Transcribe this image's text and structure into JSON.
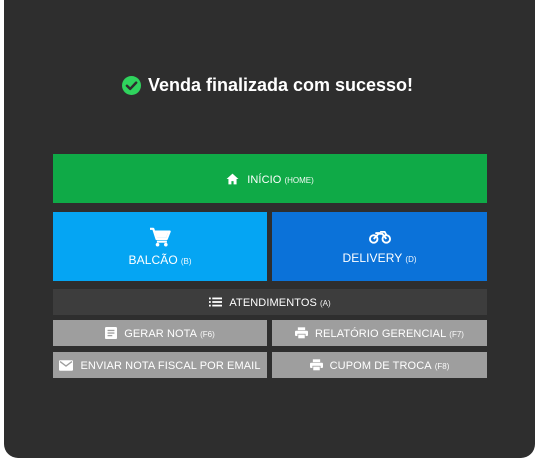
{
  "message": {
    "text": "Venda finalizada com sucesso!",
    "icon": "check-circle-icon",
    "icon_color": "#2fd35d"
  },
  "buttons": {
    "home": {
      "label": "INÍCIO",
      "key": "(HOME)",
      "icon": "home-icon",
      "color": "#0faa47"
    },
    "balcao": {
      "label": "BALCÃO",
      "key": "(B)",
      "icon": "cart-icon",
      "color": "#05a5f3"
    },
    "delivery": {
      "label": "DELIVERY",
      "key": "(D)",
      "icon": "motorcycle-icon",
      "color": "#0b72d9"
    },
    "atendimentos": {
      "label": "ATENDIMENTOS",
      "key": "(A)",
      "icon": "list-icon",
      "color": "#3d3d3d"
    },
    "gerar_nota": {
      "label": "GERAR NOTA",
      "key": "(F6)",
      "icon": "document-icon",
      "color": "#9e9e9e"
    },
    "relatorio": {
      "label": "RELATÓRIO GERENCIAL",
      "key": "(F7)",
      "icon": "printer-icon",
      "color": "#9e9e9e"
    },
    "enviar_email": {
      "label": "ENVIAR NOTA FISCAL POR EMAIL",
      "key": "",
      "icon": "mail-icon",
      "color": "#9e9e9e"
    },
    "cupom_troca": {
      "label": "CUPOM DE TROCA",
      "key": "(F8)",
      "icon": "printer-icon",
      "color": "#9e9e9e"
    }
  }
}
